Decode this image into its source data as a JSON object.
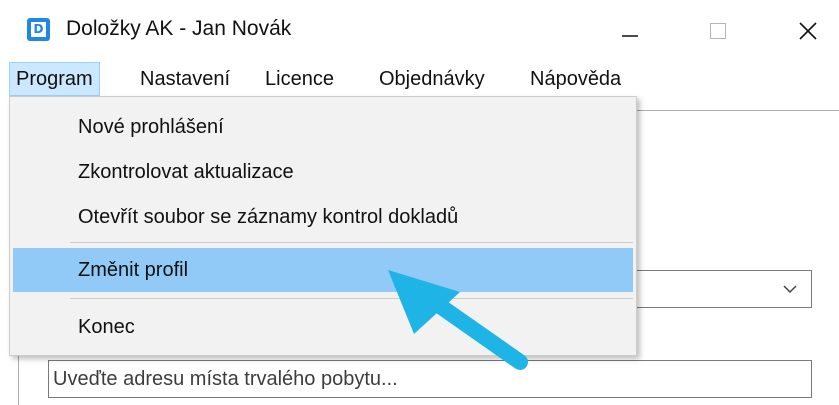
{
  "window": {
    "title": "Doložky AK - Jan Novák",
    "icon_letter": "D",
    "icon": "app-d-icon",
    "controls": [
      "minimize-icon",
      "maximize-icon",
      "close-icon"
    ],
    "brand_color": "#1e88e5"
  },
  "menubar": {
    "items": [
      {
        "label": "Program",
        "active": true
      },
      {
        "label": "Nastavení"
      },
      {
        "label": "Licence"
      },
      {
        "label": "Objednávky"
      },
      {
        "label": "Nápověda"
      }
    ]
  },
  "dropdown": {
    "items": [
      {
        "label": "Nové prohlášení"
      },
      {
        "label": "Zkontrolovat aktualizace"
      },
      {
        "label": "Otevřít soubor se záznamy kontrol dokladů"
      },
      {
        "label": "Změnit profil",
        "highlighted": true
      },
      {
        "label": "Konec"
      }
    ],
    "highlight_color": "#91c9f7"
  },
  "form": {
    "address_placeholder": "Uveďte adresu místa trvalého pobytu...",
    "select_icon": "chevron-down-icon"
  },
  "annotation": {
    "icon": "pointer-arrow-icon",
    "color": "#1eb5e6"
  }
}
